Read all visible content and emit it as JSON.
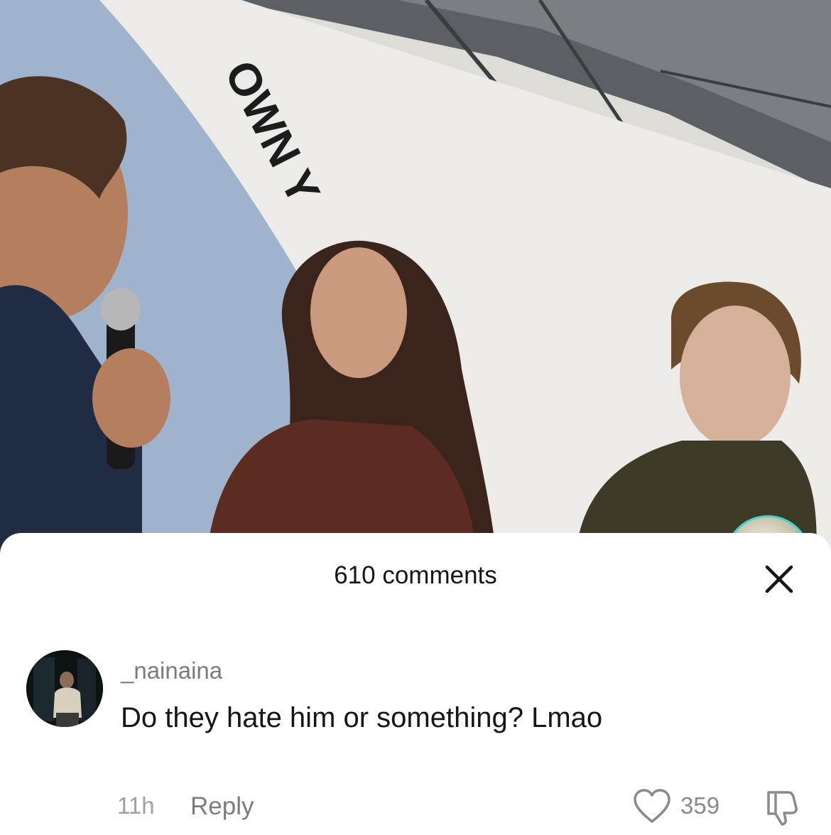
{
  "video": {
    "backdrop_text": "OWN Y"
  },
  "comments_sheet": {
    "title": "610 comments",
    "comment": {
      "username": "_nainaina",
      "text": "Do they hate him or something? Lmao",
      "timestamp": "11h",
      "reply_label": "Reply",
      "like_count": "359"
    }
  },
  "colors": {
    "sheet_background": "#ffffff",
    "primary_text": "#161616",
    "secondary_text": "#7b7b7b",
    "backdrop_blue": "#9fb3cd",
    "backdrop_white": "#ecebe7"
  },
  "icons": {
    "close": "close-icon",
    "like": "heart-outline-icon",
    "dislike": "thumbs-down-icon"
  }
}
